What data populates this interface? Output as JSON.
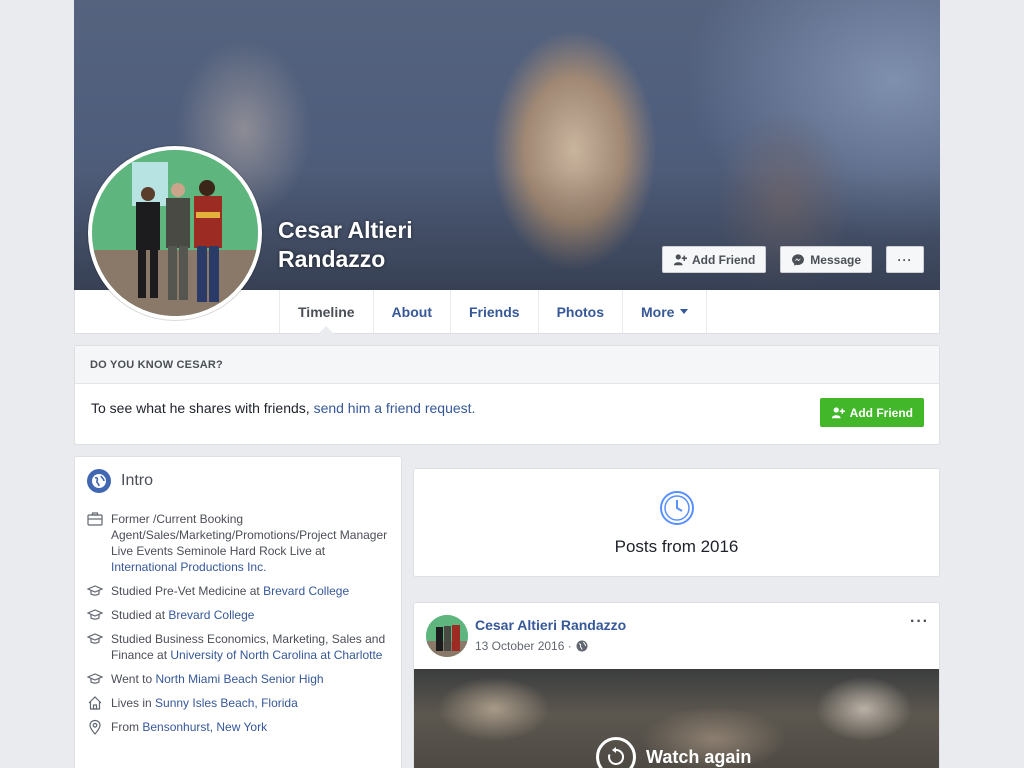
{
  "profile": {
    "name": "Cesar Altieri Randazzo",
    "add_friend_label": "Add Friend",
    "message_label": "Message",
    "more_dots": "···"
  },
  "nav": {
    "tabs": [
      {
        "label": "Timeline",
        "active": true
      },
      {
        "label": "About"
      },
      {
        "label": "Friends"
      },
      {
        "label": "Photos"
      },
      {
        "label": "More"
      }
    ]
  },
  "know": {
    "heading": "DO YOU KNOW CESAR?",
    "text": "To see what he shares with friends, ",
    "link": "send him a friend request.",
    "button": "Add Friend"
  },
  "intro": {
    "title": "Intro",
    "items": [
      {
        "icon": "briefcase-icon",
        "text": "Former /Current Booking Agent/Sales/Marketing/Promotions/Project Manager Live Events Seminole Hard Rock Live at ",
        "link": "International Productions Inc."
      },
      {
        "icon": "graduation-cap-icon",
        "text": "Studied Pre-Vet Medicine at ",
        "link": "Brevard College"
      },
      {
        "icon": "graduation-cap-icon",
        "text": "Studied at ",
        "link": "Brevard College"
      },
      {
        "icon": "graduation-cap-icon",
        "text": "Studied Business Economics, Marketing, Sales and Finance at ",
        "link": "University of North Carolina at Charlotte"
      },
      {
        "icon": "graduation-cap-icon",
        "text": "Went to ",
        "link": "North Miami Beach Senior High"
      },
      {
        "icon": "home-icon",
        "text": "Lives in ",
        "link": "Sunny Isles Beach, Florida"
      },
      {
        "icon": "location-pin-icon",
        "text": "From ",
        "link": "Bensonhurst, New York"
      }
    ]
  },
  "posts_from": {
    "label": "Posts from 2016"
  },
  "post": {
    "author": "Cesar Altieri Randazzo",
    "date": "13 October 2016 ·",
    "dots": "···",
    "watch_again": "Watch again"
  },
  "colors": {
    "link": "#365899",
    "green": "#42b72a",
    "background": "#e9ebee"
  }
}
